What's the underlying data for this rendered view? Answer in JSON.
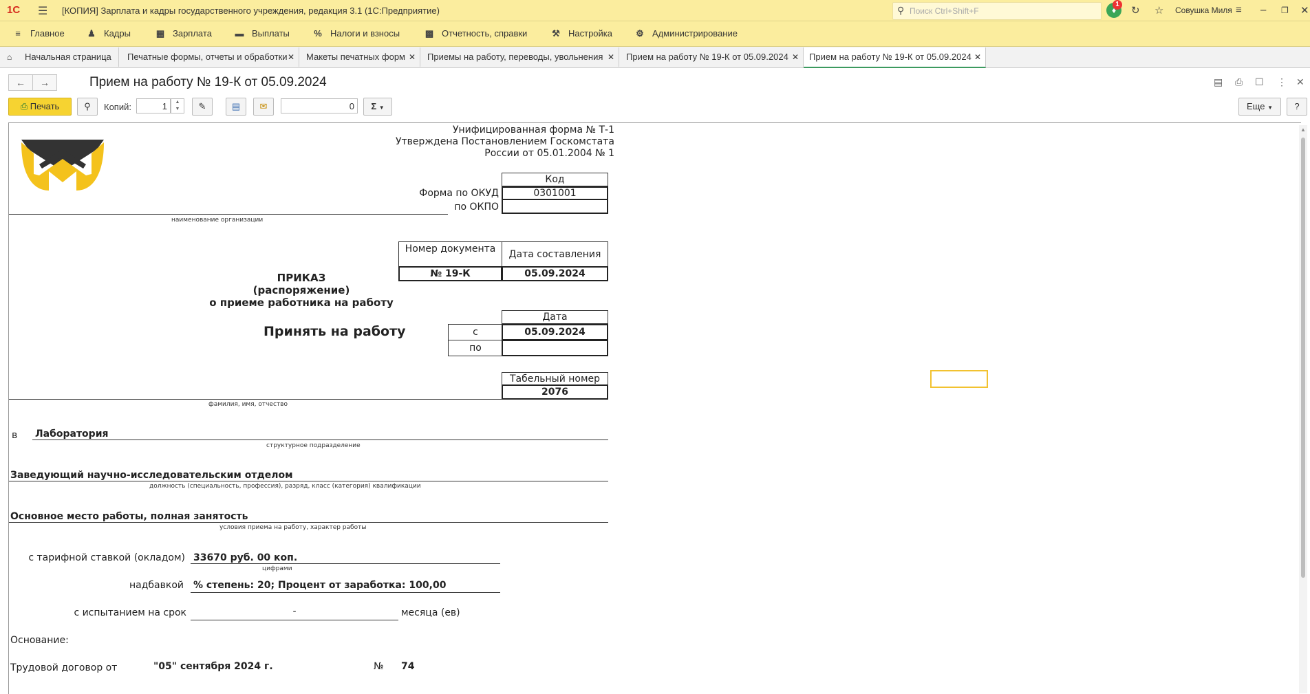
{
  "titlebar": {
    "logo": "1С",
    "title": "[КОПИЯ] Зарплата и кадры государственного учреждения, редакция 3.1  (1С:Предприятие)",
    "search_placeholder": "Поиск Ctrl+Shift+F",
    "notifications_count": "1",
    "user": "Совушка Миля"
  },
  "menu": {
    "items": [
      {
        "label": "Главное",
        "icon": "menu-lines-icon"
      },
      {
        "label": "Кадры",
        "icon": "people-icon"
      },
      {
        "label": "Зарплата",
        "icon": "calculator-icon"
      },
      {
        "label": "Выплаты",
        "icon": "wallet-icon"
      },
      {
        "label": "Налоги и взносы",
        "icon": "percent-icon"
      },
      {
        "label": "Отчетность, справки",
        "icon": "reports-icon"
      },
      {
        "label": "Настройка",
        "icon": "wrench-icon"
      },
      {
        "label": "Администрирование",
        "icon": "gear-icon"
      }
    ]
  },
  "tabs": [
    {
      "label": "Начальная страница"
    },
    {
      "label": "Печатные формы, отчеты и обработки"
    },
    {
      "label": "Макеты печатных форм"
    },
    {
      "label": "Приемы на работу, переводы, увольнения"
    },
    {
      "label": "Прием на работу № 19-К от 05.09.2024"
    },
    {
      "label": "Прием на работу № 19-К от 05.09.2024"
    }
  ],
  "header": {
    "title": "Прием на работу № 19-К от 05.09.2024"
  },
  "toolbar": {
    "print_label": "Печать",
    "copies_label": "Копий:",
    "copies_value": "1",
    "sum_value": "0",
    "sum_symbol": "Σ",
    "more_label": "Еще",
    "help_label": "?"
  },
  "form": {
    "unified_form": "Унифицированная форма № Т-1",
    "approved": "Утверждена Постановлением Госкомстата",
    "russia": "России от 05.01.2004 № 1",
    "code_header": "Код",
    "okud_label": "Форма по ОКУД",
    "okud_value": "0301001",
    "okpo_label": "по ОКПО",
    "okpo_value": "",
    "org_caption": "наименование организации",
    "docnum_header": "Номер документа",
    "date_header": "Дата составления",
    "docnum_value": "№ 19-К",
    "date_value": "05.09.2024",
    "order1": "ПРИКАЗ",
    "order2": "(распоряжение)",
    "order3": "о приеме работника на работу",
    "date_col_header": "Дата",
    "hire_label": "Принять на работу",
    "from_label": "с",
    "from_value": "05.09.2024",
    "to_label": "по",
    "to_value": "",
    "tabnum_header": "Табельный номер",
    "tabnum_value": "2076",
    "fio_caption": "фамилия, имя, отчество",
    "in_label": "в",
    "department": "Лаборатория",
    "dept_caption": "структурное подразделение",
    "position": "Заведующий научно-исследовательским отделом",
    "position_caption": "должность (специальность, профессия), разряд, класс (категория) квалификации",
    "conditions": "Основное место работы, полная занятость",
    "conditions_caption": "условия приема на работу, характер работы",
    "rate_label": "с тарифной ставкой (окладом)",
    "rate_value": "33670 руб. 00 коп.",
    "rate_caption": "цифрами",
    "bonus_label": "надбавкой",
    "bonus_value": "% степень: 20; Процент от заработка: 100,00",
    "trial_label": "с испытанием на срок",
    "trial_value": "-",
    "trial_unit": "месяца (ев)",
    "basis_label": "Основание:",
    "contract_label": "Трудовой договор от",
    "contract_date": "\"05\" сентября 2024 г.",
    "contract_no_label": "№",
    "contract_no": "74"
  }
}
